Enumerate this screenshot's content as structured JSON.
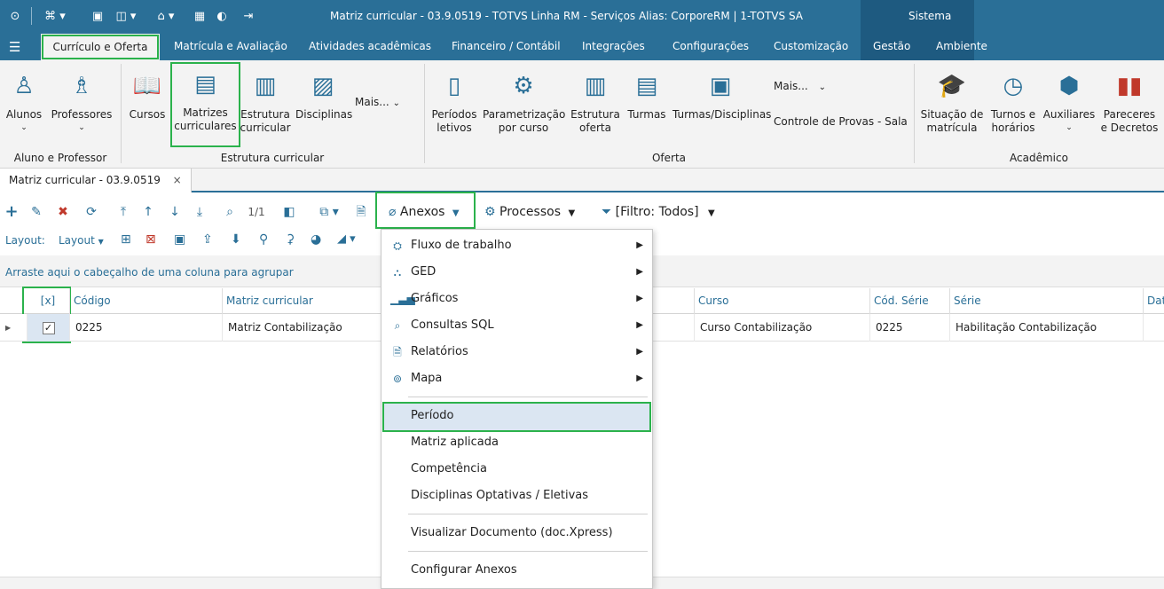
{
  "app": {
    "window_title": "Matriz curricular - 03.9.0519 - TOTVS Linha RM - Serviços  Alias: CorporeRM | 1-TOTVS SA",
    "system_label": "Sistema"
  },
  "menu": {
    "tabs": [
      {
        "label": "Currículo e Oferta"
      },
      {
        "label": "Matrícula e Avaliação"
      },
      {
        "label": "Atividades acadêmicas"
      },
      {
        "label": "Financeiro / Contábil"
      },
      {
        "label": "Integrações"
      },
      {
        "label": "Configurações"
      },
      {
        "label": "Customização"
      },
      {
        "label": "Gestão"
      },
      {
        "label": "Ambiente"
      }
    ]
  },
  "ribbon": {
    "aluno_professor": {
      "label": "Aluno e Professor",
      "alunos": "Alunos",
      "professores": "Professores"
    },
    "estrutura": {
      "label": "Estrutura curricular",
      "cursos": "Cursos",
      "matrizes_1": "Matrizes",
      "matrizes_2": "curriculares",
      "estrutura_1": "Estrutura",
      "estrutura_2": "curricular",
      "disciplinas": "Disciplinas",
      "mais": "Mais..."
    },
    "oferta": {
      "label": "Oferta",
      "periodos_1": "Períodos",
      "periodos_2": "letivos",
      "param_1": "Parametrização",
      "param_2": "por curso",
      "estr_oferta_1": "Estrutura",
      "estr_oferta_2": "oferta",
      "turmas": "Turmas",
      "turmas_disc": "Turmas/Disciplinas",
      "mais": "Mais...",
      "controle": "Controle de Provas - Sala"
    },
    "academico": {
      "label": "Acadêmico",
      "situacao_1": "Situação de",
      "situacao_2": "matrícula",
      "turnos_1": "Turnos e",
      "turnos_2": "horários",
      "auxiliares": "Auxiliares",
      "pareceres_1": "Pareceres",
      "pareceres_2": "e Decretos"
    }
  },
  "doc_tab": {
    "label": "Matriz curricular - 03.9.0519",
    "close": "×"
  },
  "toolbar": {
    "page_indicator": "1/1",
    "anexos": "Anexos",
    "processos": "Processos",
    "filtro": "[Filtro: Todos]",
    "layout_label": "Layout:",
    "layout_dropdown": "Layout"
  },
  "grid": {
    "group_hint": "Arraste aqui o cabeçalho de uma coluna para agrupar",
    "columns": [
      "[x]",
      "Código",
      "Matriz curricular",
      "Curso",
      "Cód. Série",
      "Série",
      "Dat"
    ],
    "row": {
      "codigo": "0225",
      "matriz": "Matriz Contabilização",
      "curso": "Curso Contabilização",
      "cod_serie": "0225",
      "serie": "Habilitação Contabilização"
    }
  },
  "context_menu": {
    "items": [
      {
        "label": "Fluxo de trabalho",
        "icon": "workflow-icon"
      },
      {
        "label": "GED",
        "icon": "ged-icon"
      },
      {
        "label": "Gráficos",
        "icon": "chart-icon"
      },
      {
        "label": "Consultas SQL",
        "icon": "search-icon"
      },
      {
        "label": "Relatórios",
        "icon": "report-icon"
      },
      {
        "label": "Mapa",
        "icon": "map-pin-icon"
      },
      {
        "label": "Período"
      },
      {
        "label": "Matriz aplicada"
      },
      {
        "label": "Competência"
      },
      {
        "label": "Disciplinas Optativas / Eletivas"
      },
      {
        "label": "Visualizar Documento (doc.Xpress)"
      },
      {
        "label": "Configurar Anexos"
      }
    ]
  },
  "colors": {
    "accent": "#2a6f97",
    "highlight": "#2bb24c",
    "ribbon_bg": "#f3f3f3"
  }
}
